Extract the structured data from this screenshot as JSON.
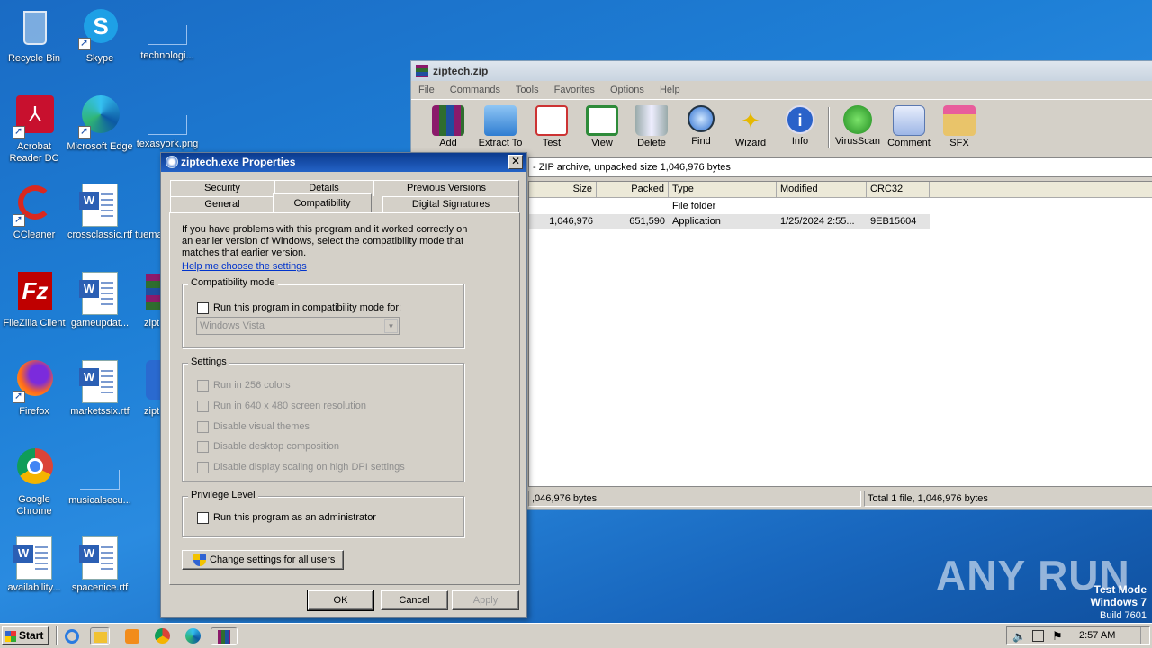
{
  "desktop": {
    "icons": [
      {
        "label": "Recycle Bin"
      },
      {
        "label": "Skype"
      },
      {
        "label": "technologi..."
      },
      {
        "label": "Acrobat Reader DC"
      },
      {
        "label": "Microsoft Edge"
      },
      {
        "label": "texasyork.png"
      },
      {
        "label": "CCleaner"
      },
      {
        "label": "crossclassic.rtf"
      },
      {
        "label": "tuema..."
      },
      {
        "label": "FileZilla Client"
      },
      {
        "label": "gameupdat..."
      },
      {
        "label": "zipt..."
      },
      {
        "label": "Firefox"
      },
      {
        "label": "marketssix.rtf"
      },
      {
        "label": "zipt..."
      },
      {
        "label": "Google Chrome"
      },
      {
        "label": "musicalsecu..."
      },
      {
        "label": "availability..."
      },
      {
        "label": "spacenice.rtf"
      }
    ]
  },
  "winrar": {
    "title": "ziptech.zip",
    "menu": [
      "File",
      "Commands",
      "Tools",
      "Favorites",
      "Options",
      "Help"
    ],
    "toolbar": [
      "Add",
      "Extract To",
      "Test",
      "View",
      "Delete",
      "Find",
      "Wizard",
      "Info",
      "VirusScan",
      "Comment",
      "SFX"
    ],
    "address": "- ZIP archive, unpacked size 1,046,976 bytes",
    "columns": [
      "Size",
      "Packed",
      "Type",
      "Modified",
      "CRC32"
    ],
    "rows": [
      {
        "size": "",
        "packed": "",
        "type": "File folder",
        "modified": "",
        "crc": ""
      },
      {
        "size": "1,046,976",
        "packed": "651,590",
        "type": "Application",
        "modified": "1/25/2024 2:55...",
        "crc": "9EB15604"
      }
    ],
    "status_left": ",046,976 bytes",
    "status_right": "Total 1 file, 1,046,976 bytes"
  },
  "dialog": {
    "title": "ziptech.exe Properties",
    "close": "✕",
    "tabs_back": [
      "Security",
      "Details",
      "Previous Versions"
    ],
    "tabs_front": [
      "General",
      "Compatibility",
      "Digital Signatures"
    ],
    "intro": "If you have problems with this program and it worked correctly on an earlier version of Windows, select the compatibility mode that matches that earlier version.",
    "help_link": "Help me choose the settings",
    "compat_group": "Compatibility mode",
    "compat_check": "Run this program in compatibility mode for:",
    "compat_select": "Windows Vista",
    "settings_group": "Settings",
    "settings": [
      "Run in 256 colors",
      "Run in 640 x 480 screen resolution",
      "Disable visual themes",
      "Disable desktop composition",
      "Disable display scaling on high DPI settings"
    ],
    "priv_group": "Privilege Level",
    "priv_check": "Run this program as an administrator",
    "change_all": "Change settings for all users",
    "ok": "OK",
    "cancel": "Cancel",
    "apply": "Apply"
  },
  "taskbar": {
    "start": "Start",
    "clock": "2:57 AM"
  },
  "watermark": {
    "brand": "ANY RUN",
    "line1": "Test Mode",
    "line2": "Windows 7",
    "line3": "Build 7601"
  }
}
